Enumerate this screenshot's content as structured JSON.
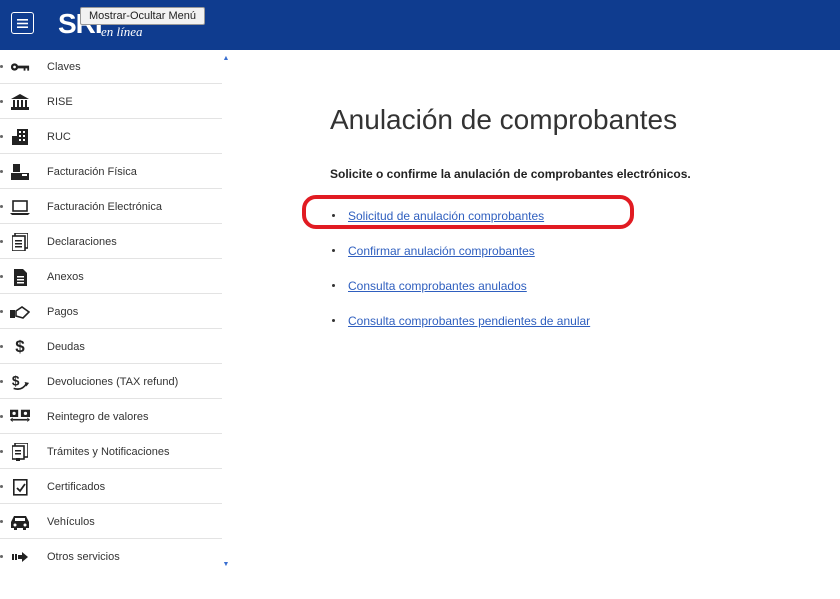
{
  "header": {
    "menu_icon": "hamburger-icon",
    "logo_text": "SRI",
    "logo_subtext": "en línea",
    "tooltip": "Mostrar-Ocultar Menú"
  },
  "sidebar": {
    "items": [
      {
        "label": "Claves",
        "icon": "key-icon"
      },
      {
        "label": "RISE",
        "icon": "bank-icon"
      },
      {
        "label": "RUC",
        "icon": "building-icon"
      },
      {
        "label": "Facturación Física",
        "icon": "printer-icon"
      },
      {
        "label": "Facturación Electrónica",
        "icon": "laptop-icon"
      },
      {
        "label": "Declaraciones",
        "icon": "document-icon"
      },
      {
        "label": "Anexos",
        "icon": "file-icon"
      },
      {
        "label": "Pagos",
        "icon": "payment-hand-icon"
      },
      {
        "label": "Deudas",
        "icon": "dollar-icon"
      },
      {
        "label": "Devoluciones (TAX refund)",
        "icon": "refund-icon"
      },
      {
        "label": "Reintegro de valores",
        "icon": "money-exchange-icon"
      },
      {
        "label": "Trámites y Notificaciones",
        "icon": "notification-doc-icon"
      },
      {
        "label": "Certificados",
        "icon": "certificate-icon"
      },
      {
        "label": "Vehículos",
        "icon": "car-icon"
      },
      {
        "label": "Otros servicios",
        "icon": "arrow-right-icon"
      }
    ]
  },
  "main": {
    "title": "Anulación de comprobantes",
    "subtitle": "Solicite o confirme la anulación de comprobantes electrónicos.",
    "links": [
      {
        "label": "Solicitud de anulación comprobantes"
      },
      {
        "label": "Confirmar anulación comprobantes"
      },
      {
        "label": "Consulta comprobantes anulados"
      },
      {
        "label": "Consulta comprobantes pendientes de anular"
      }
    ]
  },
  "colors": {
    "header_bg": "#0f3c8f",
    "link": "#2f5fbf",
    "highlight": "#e11b22"
  }
}
